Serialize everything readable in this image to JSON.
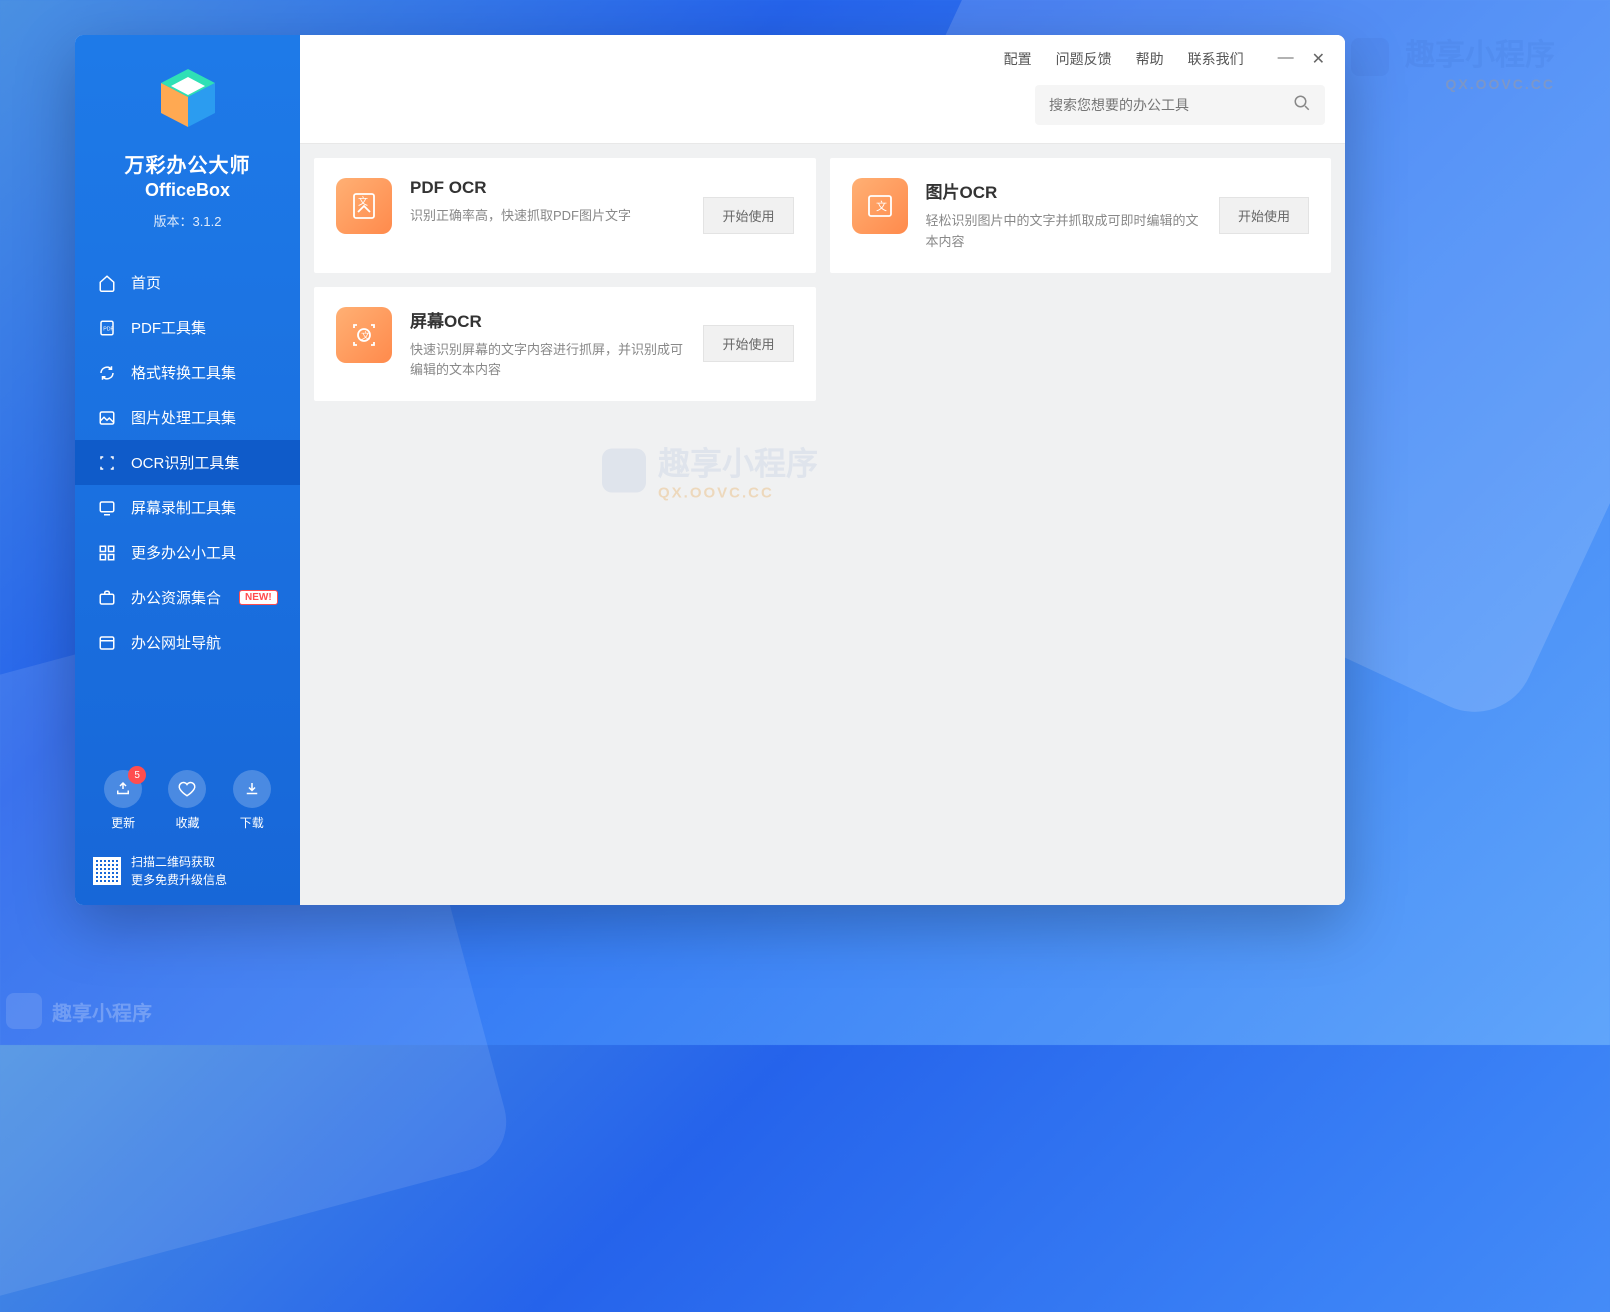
{
  "watermark": {
    "text": "趣享小程序",
    "sub": "QX.OOVC.CC"
  },
  "app": {
    "title": "万彩办公大师",
    "subtitle": "OfficeBox",
    "version_label": "版本：3.1.2"
  },
  "topbar": {
    "config": "配置",
    "feedback": "问题反馈",
    "help": "帮助",
    "contact": "联系我们"
  },
  "search": {
    "placeholder": "搜索您想要的办公工具"
  },
  "nav": [
    {
      "label": "首页"
    },
    {
      "label": "PDF工具集"
    },
    {
      "label": "格式转换工具集"
    },
    {
      "label": "图片处理工具集"
    },
    {
      "label": "OCR识别工具集",
      "active": true
    },
    {
      "label": "屏幕录制工具集"
    },
    {
      "label": "更多办公小工具"
    },
    {
      "label": "办公资源集合",
      "new": "NEW!"
    },
    {
      "label": "办公网址导航"
    }
  ],
  "bottom": {
    "update": "更新",
    "update_badge": "5",
    "favorite": "收藏",
    "download": "下载"
  },
  "qr": {
    "line1": "扫描二维码获取",
    "line2": "更多免费升级信息"
  },
  "cards": [
    {
      "title": "PDF OCR",
      "desc": "识别正确率高，快速抓取PDF图片文字",
      "button": "开始使用"
    },
    {
      "title": "图片OCR",
      "desc": "轻松识别图片中的文字并抓取成可即时编辑的文本内容",
      "button": "开始使用"
    },
    {
      "title": "屏幕OCR",
      "desc": "快速识别屏幕的文字内容进行抓屏，并识别成可编辑的文本内容",
      "button": "开始使用"
    }
  ]
}
